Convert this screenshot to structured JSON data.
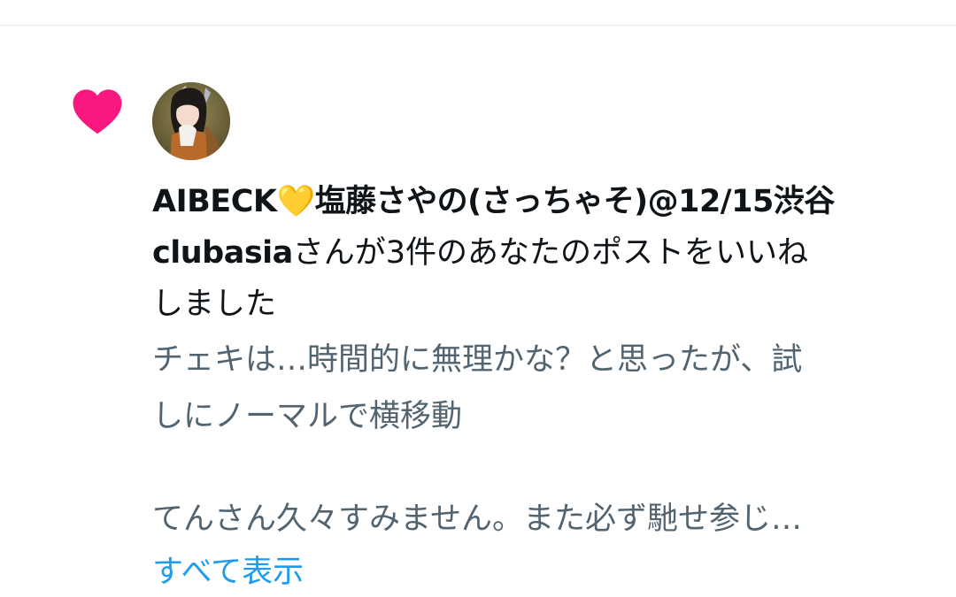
{
  "notification": {
    "type_icon": "heart-icon",
    "type_icon_color": "#f91880",
    "avatar": "user-avatar",
    "actor_name_line1": "AIBECK",
    "emoji": "💛",
    "actor_name_line1_rest": "塩藤さやの(さっちゃそ)@12/15渋谷",
    "actor_name_line2": "clubasia",
    "action_text_line1": "さんが3件のあなたのポストをいいね",
    "action_text_line2": "しました",
    "preview_lines": [
      "チェキは…時間的に無理かな？と思ったが、試",
      "しにノーマルで横移動",
      "てんさん久々すみません。また必ず馳せ参じ…"
    ],
    "show_more_label": "すべて表示"
  },
  "colors": {
    "accent": "#1d9bf0",
    "primary_text": "#0f1419",
    "secondary_text": "#536471",
    "like": "#f91880",
    "divider": "#e6e9ec"
  }
}
